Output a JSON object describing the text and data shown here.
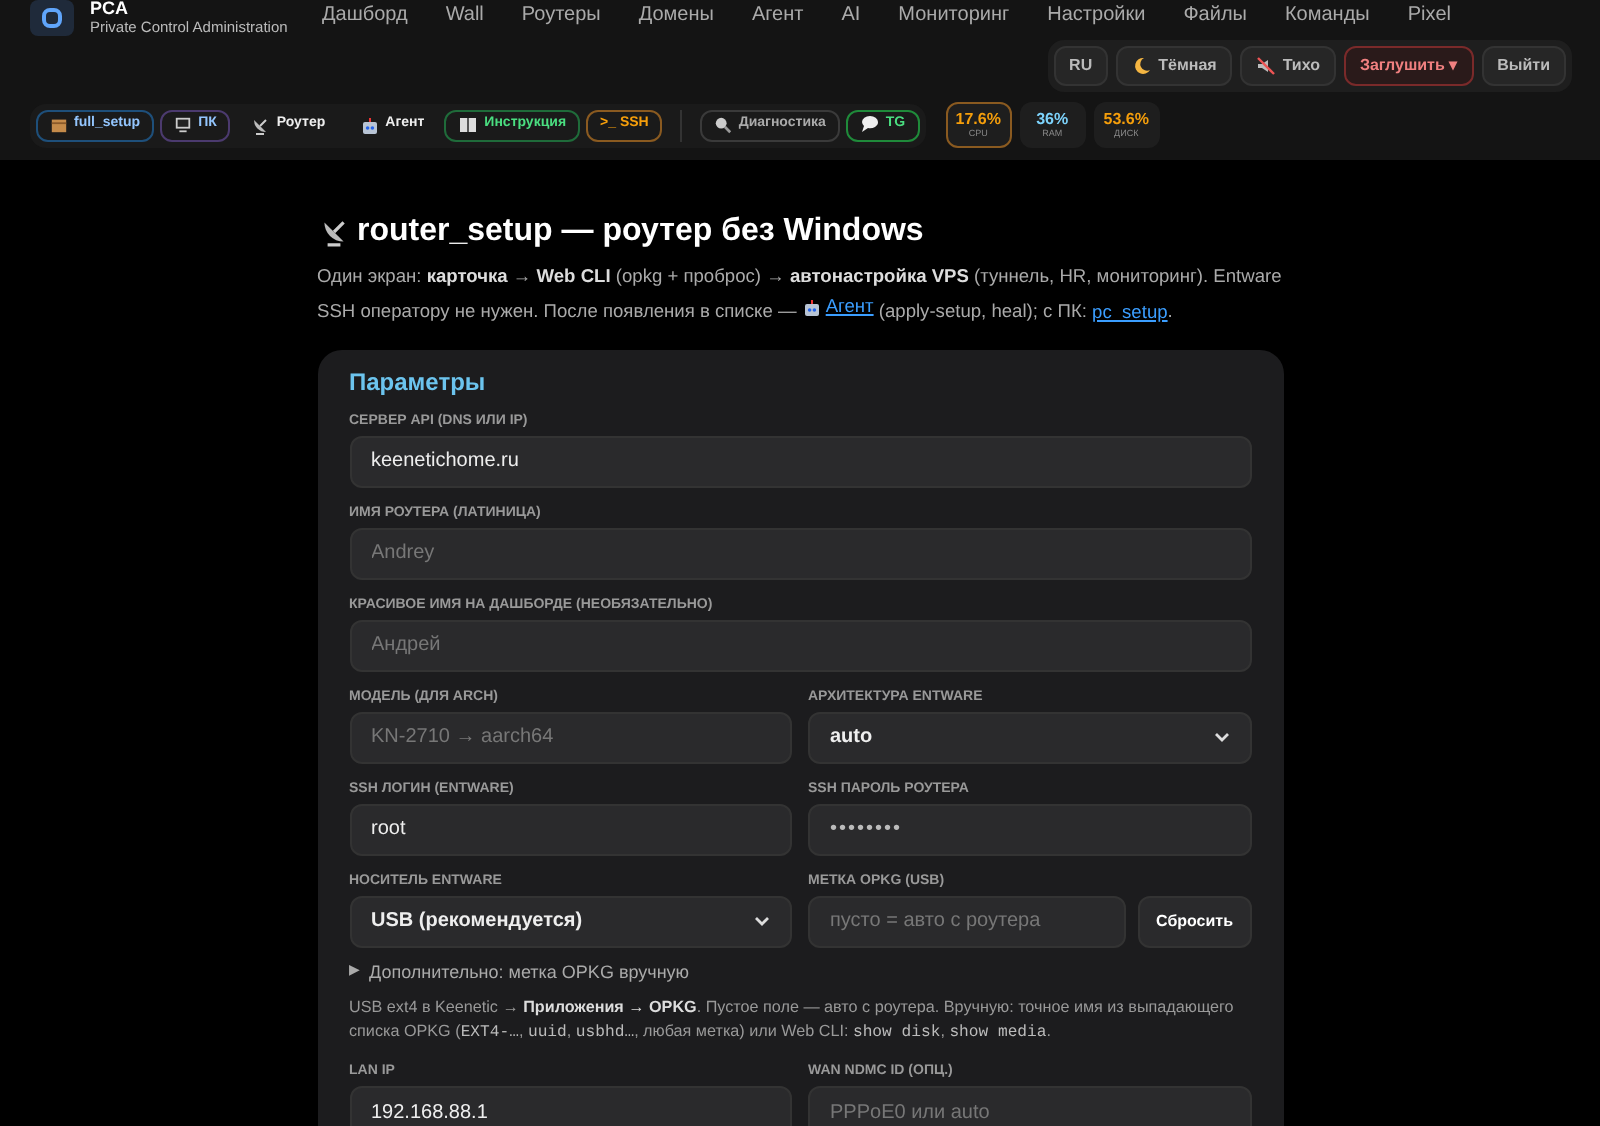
{
  "brand": {
    "title": "PCA",
    "subtitle": "Private Control Administration"
  },
  "nav": [
    "Дашборд",
    "Wall",
    "Роутеры",
    "Домены",
    "Агент",
    "AI",
    "Мониторинг",
    "Настройки",
    "Файлы",
    "Команды",
    "Pixel"
  ],
  "controls": [
    {
      "label": "RU",
      "kind": "plain"
    },
    {
      "label": "Тёмная",
      "kind": "moon"
    },
    {
      "label": "Тихо",
      "kind": "mute"
    },
    {
      "label": "Заглушить ▾",
      "kind": "danger"
    },
    {
      "label": "Выйти",
      "kind": "plain"
    }
  ],
  "toolbar": [
    {
      "label": "full_setup",
      "kind": "box",
      "color": "#1e4f7a"
    },
    {
      "label": "ПК",
      "kind": "pc",
      "color": "#4b3a6e"
    },
    {
      "label": "Роутер",
      "kind": "dish"
    },
    {
      "label": "Агент",
      "kind": "robot"
    },
    {
      "label": "Инструкция",
      "kind": "book",
      "color": "#1f6b3a"
    },
    {
      "label": ">_ SSH",
      "kind": "plain",
      "color": "#8a5a20"
    },
    {
      "label": "Диагностика",
      "kind": "search",
      "color": "#3a3a3a"
    },
    {
      "label": "TG",
      "kind": "chat",
      "color": "#1f8a3a"
    }
  ],
  "stats": [
    {
      "value": "17.6%",
      "label": "CPU",
      "color": "#f59e0b",
      "highlighted": true
    },
    {
      "value": "36%",
      "label": "RAM",
      "color": "#7dd3fc",
      "highlighted": false
    },
    {
      "value": "53.6%",
      "label": "ДИСК",
      "color": "#f59e0b",
      "highlighted": false
    }
  ],
  "page": {
    "title": "router_setup — роутер без Windows",
    "intro": [
      {
        "kind": "text",
        "text": "Один экран: **карточка** → **Web CLI** (opkg + проброс) → **автонастройка VPS** (туннель, HR, мониторинг). Entware SSH оператору не нужен. После появления в списке — "
      },
      {
        "kind": "agentlink",
        "text": "Агент"
      },
      {
        "kind": "text",
        "text": " (apply-setup, heal); с ПК: "
      },
      {
        "kind": "link",
        "text": "pc_setup"
      },
      {
        "kind": "text",
        "text": "."
      }
    ],
    "card_title": "Параметры",
    "rows": [
      [
        {
          "label": "СЕРВЕР API (DNS ИЛИ IP)",
          "kind": "input",
          "value": "keenetichome.ru"
        }
      ],
      [
        {
          "label": "ИМЯ РОУТЕРА (ЛАТИНИЦА)",
          "kind": "input",
          "placeholder": "Andrey"
        }
      ],
      [
        {
          "label": "КРАСИВОЕ ИМЯ НА ДАШБОРДЕ (НЕОБЯЗАТЕЛЬНО)",
          "kind": "input",
          "placeholder": "Андрей"
        }
      ],
      [
        {
          "label": "МОДЕЛЬ (ДЛЯ ARCH)",
          "kind": "input",
          "placeholder": "KN-2710 → aarch64"
        },
        {
          "label": "АРХИТЕКТУРА ENTWARE",
          "kind": "select",
          "value": "auto"
        }
      ],
      [
        {
          "label": "SSH ЛОГИН (ENTWARE)",
          "kind": "input",
          "value": "root"
        },
        {
          "label": "SSH ПАРОЛЬ РОУТЕРА",
          "kind": "password",
          "value": "••••••••"
        }
      ],
      [
        {
          "label": "НОСИТЕЛЬ ENTWARE",
          "kind": "select",
          "value": "USB (рекомендуется)"
        },
        {
          "label": "МЕТКА OPKG (USB)",
          "kind": "input",
          "placeholder": "пусто = авто с роутера",
          "button": "Сбросить"
        }
      ]
    ],
    "details": {
      "marker": "▶",
      "label": "Дополнительно: метка OPKG вручную",
      "expanded": false
    },
    "help": [
      {
        "kind": "text",
        "text": "USB ext4 в Keenetic → **Приложения → OPKG**. Пустое поле — авто с роутера. Вручную: точное имя из выпадающего списка OPKG ("
      },
      {
        "kind": "code",
        "text": "EXT4-…"
      },
      {
        "kind": "text",
        "text": ", "
      },
      {
        "kind": "code",
        "text": "uuid"
      },
      {
        "kind": "text",
        "text": ", "
      },
      {
        "kind": "code",
        "text": "usbhd…"
      },
      {
        "kind": "text",
        "text": ", любая метка) или Web CLI: "
      },
      {
        "kind": "code",
        "text": "show disk"
      },
      {
        "kind": "text",
        "text": ", "
      },
      {
        "kind": "code",
        "text": "show media"
      },
      {
        "kind": "text",
        "text": "."
      }
    ],
    "rows2": [
      [
        {
          "label": "LAN IP",
          "kind": "input",
          "value": "192.168.88.1"
        },
        {
          "label": "WAN NDMC ID (ОПЦ.)",
          "kind": "input",
          "placeholder": "PPPoE0 или auto"
        }
      ]
    ]
  }
}
